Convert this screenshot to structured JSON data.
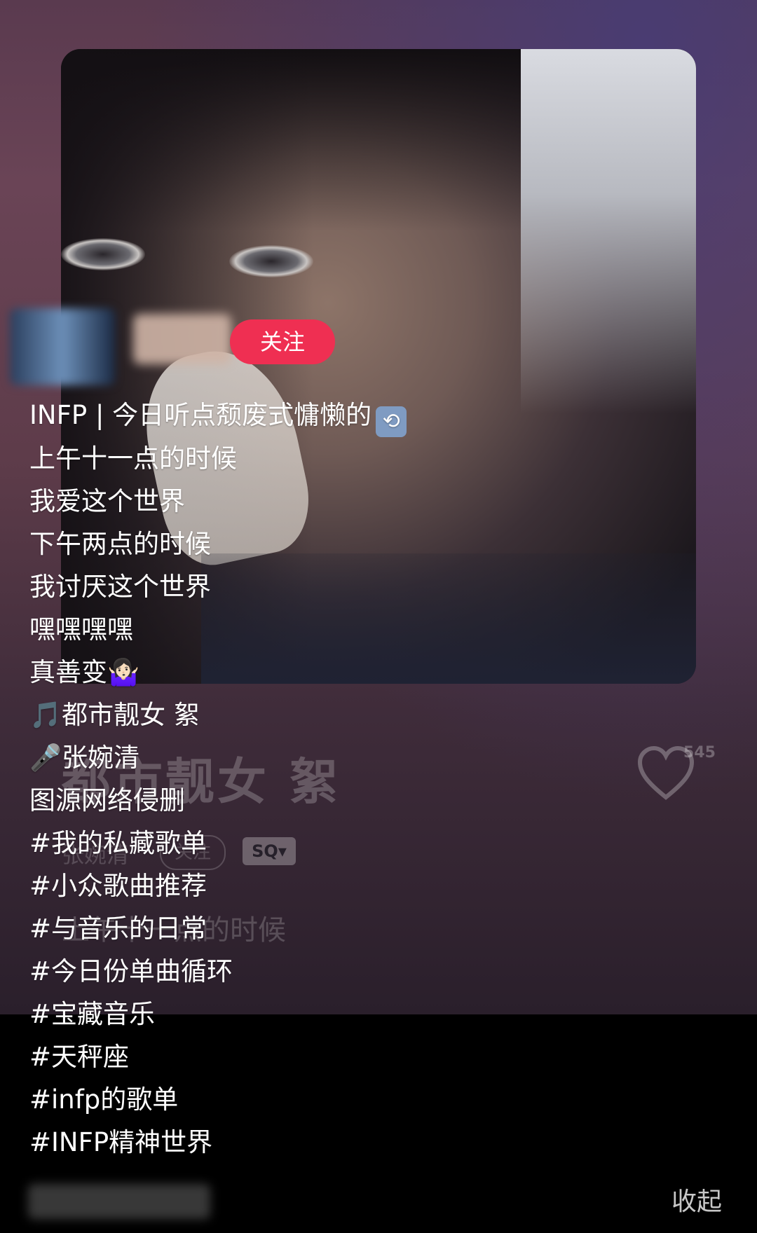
{
  "header": {
    "follow_label": "关注"
  },
  "caption": {
    "title_line": "INFP | 今日听点颓废式慵懒的",
    "title_emoji": "repeat-icon",
    "lines": [
      "上午十一点的时候",
      "我爱这个世界",
      "下午两点的时候",
      "我讨厌这个世界",
      "嘿嘿嘿嘿",
      "真善变🤷🏻‍♀️",
      "🎵都市靓女 絮",
      "🎤张婉清",
      "图源网络侵删",
      "#我的私藏歌单",
      "#小众歌曲推荐",
      "#与音乐的日常",
      "#今日份单曲循环",
      "#宝藏音乐",
      "#天秤座",
      "#infp的歌单",
      "#INFP精神世界"
    ]
  },
  "player": {
    "title": "都市靓女 絮",
    "artist": "张婉清",
    "follow": "关注",
    "quality_badge": "SQ▾",
    "lyric": "上午十一点的时候",
    "like_count": "545"
  },
  "footer": {
    "collapse_label": "收起"
  },
  "colors": {
    "follow_button": "#ef2f52",
    "text": "#ffffff",
    "bottom_bar": "#000000"
  }
}
